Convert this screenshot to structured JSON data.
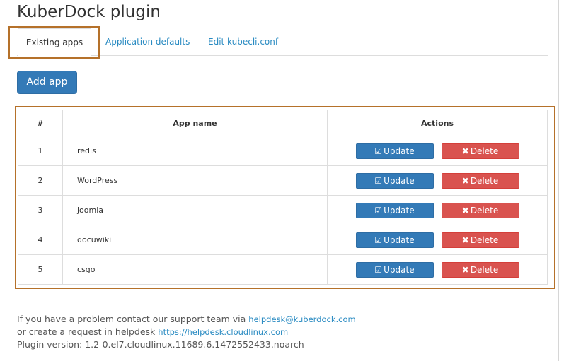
{
  "page": {
    "title": "KuberDock plugin"
  },
  "tabs": [
    {
      "label": "Existing apps",
      "active": true
    },
    {
      "label": "Application defaults",
      "active": false
    },
    {
      "label": "Edit kubecli.conf",
      "active": false
    }
  ],
  "toolbar": {
    "add_label": "Add app"
  },
  "table": {
    "headers": {
      "num": "#",
      "name": "App name",
      "actions": "Actions"
    },
    "rows": [
      {
        "num": "1",
        "name": "redis"
      },
      {
        "num": "2",
        "name": "WordPress"
      },
      {
        "num": "3",
        "name": "joomla"
      },
      {
        "num": "4",
        "name": "docuwiki"
      },
      {
        "num": "5",
        "name": "csgo"
      }
    ],
    "update_label": "Update",
    "delete_label": "Delete",
    "update_icon": "edit-icon",
    "delete_icon": "times-icon"
  },
  "footer": {
    "line1_text": "If you have a problem contact our support team via",
    "email": "helpdesk@kuberdock.com",
    "line2_text": "or create a request in helpdesk",
    "helpdesk_url": "https://helpdesk.cloudlinux.com",
    "version_text": "Plugin version: 1.2-0.el7.cloudlinux.11689.6.1472552433.noarch"
  },
  "colors": {
    "primary": "#337ab7",
    "danger": "#d9534f",
    "link": "#2a8bc2",
    "highlight": "#b5712a"
  }
}
